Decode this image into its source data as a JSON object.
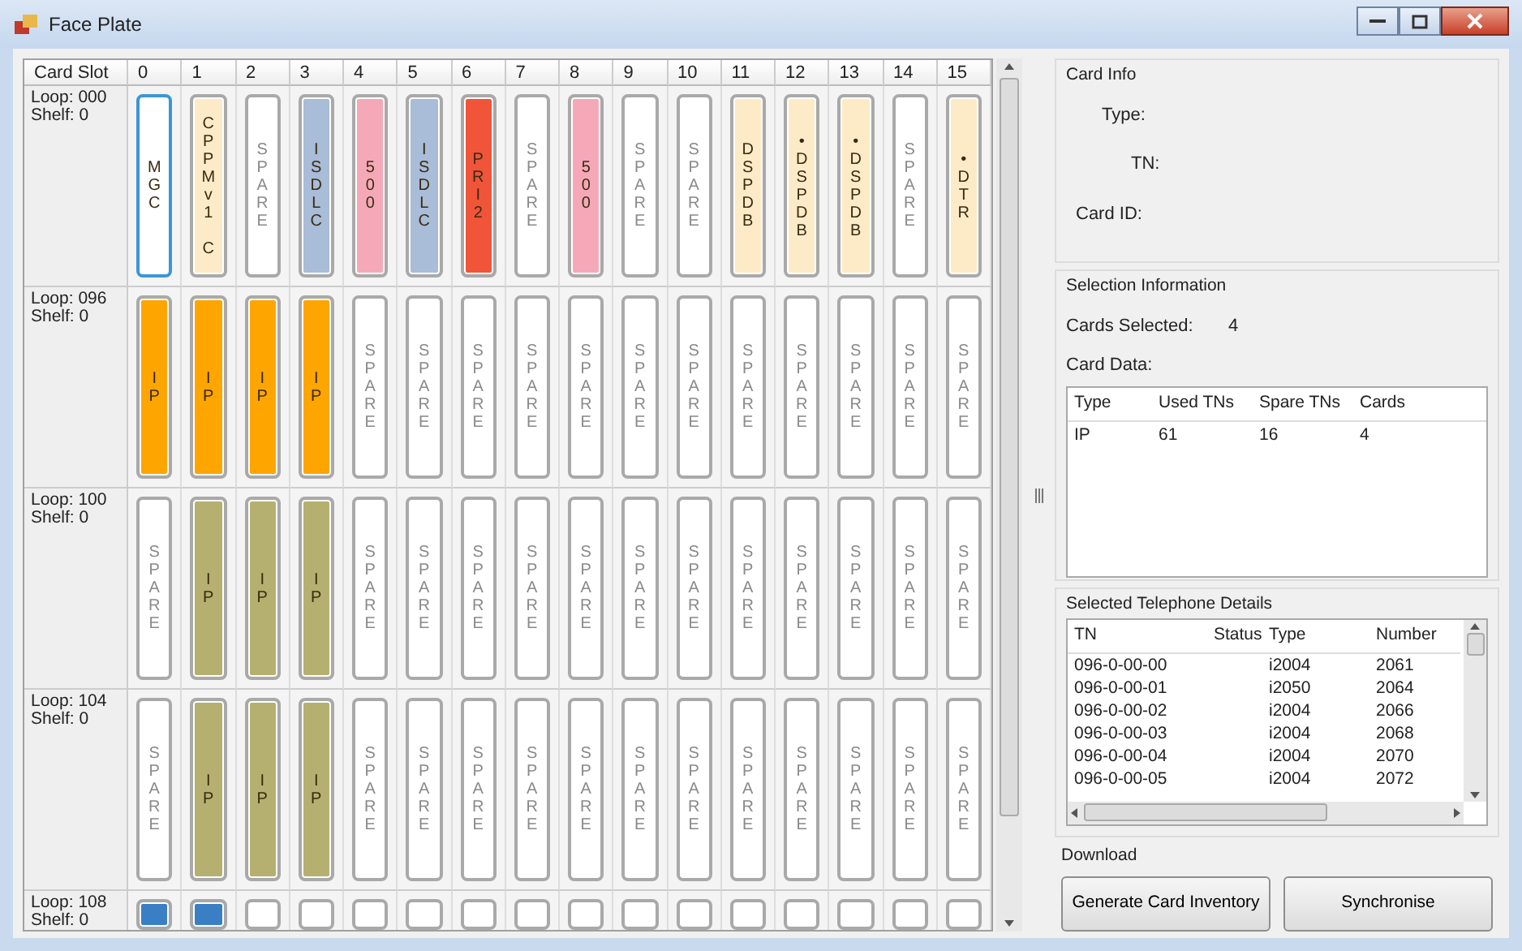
{
  "window": {
    "title": "Face Plate"
  },
  "grid": {
    "columns": [
      "Card Slot",
      "0",
      "1",
      "2",
      "3",
      "4",
      "5",
      "6",
      "7",
      "8",
      "9",
      "10",
      "11",
      "12",
      "13",
      "14",
      "15"
    ],
    "rows": [
      {
        "loop": "Loop: 000",
        "shelf": "Shelf: 0",
        "cards": [
          {
            "kind": "card",
            "label": "MGC",
            "color": "#ffffff",
            "selected": true
          },
          {
            "kind": "card",
            "label": "CPPMv1 C",
            "color": "#fdebc8",
            "selected": false
          },
          {
            "kind": "spare",
            "label": "SPARE",
            "color": "#ffffff",
            "selected": false
          },
          {
            "kind": "card",
            "label": "ISDLC",
            "color": "#a9bcd8",
            "selected": false
          },
          {
            "kind": "card",
            "label": "500",
            "color": "#f5a9b8",
            "selected": false
          },
          {
            "kind": "card",
            "label": "ISDLC",
            "color": "#a9bcd8",
            "selected": false
          },
          {
            "kind": "card",
            "label": "PRI2",
            "color": "#f0553a",
            "selected": false
          },
          {
            "kind": "spare",
            "label": "SPARE",
            "color": "#ffffff",
            "selected": false
          },
          {
            "kind": "card",
            "label": "500",
            "color": "#f5a9b8",
            "selected": false
          },
          {
            "kind": "spare",
            "label": "SPARE",
            "color": "#ffffff",
            "selected": false
          },
          {
            "kind": "spare",
            "label": "SPARE",
            "color": "#ffffff",
            "selected": false
          },
          {
            "kind": "card",
            "label": "DSPDB",
            "color": "#fdebc8",
            "selected": false
          },
          {
            "kind": "card",
            "label": "•DSPDB",
            "color": "#fdebc8",
            "selected": false
          },
          {
            "kind": "card",
            "label": "•DSPDB",
            "color": "#fdebc8",
            "selected": false
          },
          {
            "kind": "spare",
            "label": "SPARE",
            "color": "#ffffff",
            "selected": false
          },
          {
            "kind": "card",
            "label": "•DTR",
            "color": "#fdebc8",
            "selected": false
          }
        ]
      },
      {
        "loop": "Loop: 096",
        "shelf": "Shelf: 0",
        "cards": [
          {
            "kind": "card",
            "label": "IP",
            "color": "#ffa500",
            "selected": false
          },
          {
            "kind": "card",
            "label": "IP",
            "color": "#ffa500",
            "selected": false
          },
          {
            "kind": "card",
            "label": "IP",
            "color": "#ffa500",
            "selected": false
          },
          {
            "kind": "card",
            "label": "IP",
            "color": "#ffa500",
            "selected": false
          },
          {
            "kind": "spare",
            "label": "SPARE",
            "color": "#ffffff",
            "selected": false
          },
          {
            "kind": "spare",
            "label": "SPARE",
            "color": "#ffffff",
            "selected": false
          },
          {
            "kind": "spare",
            "label": "SPARE",
            "color": "#ffffff",
            "selected": false
          },
          {
            "kind": "spare",
            "label": "SPARE",
            "color": "#ffffff",
            "selected": false
          },
          {
            "kind": "spare",
            "label": "SPARE",
            "color": "#ffffff",
            "selected": false
          },
          {
            "kind": "spare",
            "label": "SPARE",
            "color": "#ffffff",
            "selected": false
          },
          {
            "kind": "spare",
            "label": "SPARE",
            "color": "#ffffff",
            "selected": false
          },
          {
            "kind": "spare",
            "label": "SPARE",
            "color": "#ffffff",
            "selected": false
          },
          {
            "kind": "spare",
            "label": "SPARE",
            "color": "#ffffff",
            "selected": false
          },
          {
            "kind": "spare",
            "label": "SPARE",
            "color": "#ffffff",
            "selected": false
          },
          {
            "kind": "spare",
            "label": "SPARE",
            "color": "#ffffff",
            "selected": false
          },
          {
            "kind": "spare",
            "label": "SPARE",
            "color": "#ffffff",
            "selected": false
          }
        ]
      },
      {
        "loop": "Loop: 100",
        "shelf": "Shelf: 0",
        "cards": [
          {
            "kind": "spare",
            "label": "SPARE",
            "color": "#ffffff",
            "selected": false
          },
          {
            "kind": "card",
            "label": "IP",
            "color": "#b5b070",
            "selected": false
          },
          {
            "kind": "card",
            "label": "IP",
            "color": "#b5b070",
            "selected": false
          },
          {
            "kind": "card",
            "label": "IP",
            "color": "#b5b070",
            "selected": false
          },
          {
            "kind": "spare",
            "label": "SPARE",
            "color": "#ffffff",
            "selected": false
          },
          {
            "kind": "spare",
            "label": "SPARE",
            "color": "#ffffff",
            "selected": false
          },
          {
            "kind": "spare",
            "label": "SPARE",
            "color": "#ffffff",
            "selected": false
          },
          {
            "kind": "spare",
            "label": "SPARE",
            "color": "#ffffff",
            "selected": false
          },
          {
            "kind": "spare",
            "label": "SPARE",
            "color": "#ffffff",
            "selected": false
          },
          {
            "kind": "spare",
            "label": "SPARE",
            "color": "#ffffff",
            "selected": false
          },
          {
            "kind": "spare",
            "label": "SPARE",
            "color": "#ffffff",
            "selected": false
          },
          {
            "kind": "spare",
            "label": "SPARE",
            "color": "#ffffff",
            "selected": false
          },
          {
            "kind": "spare",
            "label": "SPARE",
            "color": "#ffffff",
            "selected": false
          },
          {
            "kind": "spare",
            "label": "SPARE",
            "color": "#ffffff",
            "selected": false
          },
          {
            "kind": "spare",
            "label": "SPARE",
            "color": "#ffffff",
            "selected": false
          },
          {
            "kind": "spare",
            "label": "SPARE",
            "color": "#ffffff",
            "selected": false
          }
        ]
      },
      {
        "loop": "Loop: 104",
        "shelf": "Shelf: 0",
        "cards": [
          {
            "kind": "spare",
            "label": "SPARE",
            "color": "#ffffff",
            "selected": false
          },
          {
            "kind": "card",
            "label": "IP",
            "color": "#b5b070",
            "selected": false
          },
          {
            "kind": "card",
            "label": "IP",
            "color": "#b5b070",
            "selected": false
          },
          {
            "kind": "card",
            "label": "IP",
            "color": "#b5b070",
            "selected": false
          },
          {
            "kind": "spare",
            "label": "SPARE",
            "color": "#ffffff",
            "selected": false
          },
          {
            "kind": "spare",
            "label": "SPARE",
            "color": "#ffffff",
            "selected": false
          },
          {
            "kind": "spare",
            "label": "SPARE",
            "color": "#ffffff",
            "selected": false
          },
          {
            "kind": "spare",
            "label": "SPARE",
            "color": "#ffffff",
            "selected": false
          },
          {
            "kind": "spare",
            "label": "SPARE",
            "color": "#ffffff",
            "selected": false
          },
          {
            "kind": "spare",
            "label": "SPARE",
            "color": "#ffffff",
            "selected": false
          },
          {
            "kind": "spare",
            "label": "SPARE",
            "color": "#ffffff",
            "selected": false
          },
          {
            "kind": "spare",
            "label": "SPARE",
            "color": "#ffffff",
            "selected": false
          },
          {
            "kind": "spare",
            "label": "SPARE",
            "color": "#ffffff",
            "selected": false
          },
          {
            "kind": "spare",
            "label": "SPARE",
            "color": "#ffffff",
            "selected": false
          },
          {
            "kind": "spare",
            "label": "SPARE",
            "color": "#ffffff",
            "selected": false
          },
          {
            "kind": "spare",
            "label": "SPARE",
            "color": "#ffffff",
            "selected": false
          }
        ]
      },
      {
        "loop": "Loop: 108",
        "shelf": "Shelf: 0",
        "cards": [
          {
            "kind": "empty",
            "color": "#3a7fc4",
            "selected": false
          },
          {
            "kind": "empty",
            "color": "#3a7fc4",
            "selected": false
          },
          {
            "kind": "empty",
            "color": "#ffffff",
            "selected": false
          },
          {
            "kind": "empty",
            "color": "#ffffff",
            "selected": false
          },
          {
            "kind": "empty",
            "color": "#ffffff",
            "selected": false
          },
          {
            "kind": "empty",
            "color": "#ffffff",
            "selected": false
          },
          {
            "kind": "empty",
            "color": "#ffffff",
            "selected": false
          },
          {
            "kind": "empty",
            "color": "#ffffff",
            "selected": false
          },
          {
            "kind": "empty",
            "color": "#ffffff",
            "selected": false
          },
          {
            "kind": "empty",
            "color": "#ffffff",
            "selected": false
          },
          {
            "kind": "empty",
            "color": "#ffffff",
            "selected": false
          },
          {
            "kind": "empty",
            "color": "#ffffff",
            "selected": false
          },
          {
            "kind": "empty",
            "color": "#ffffff",
            "selected": false
          },
          {
            "kind": "empty",
            "color": "#ffffff",
            "selected": false
          },
          {
            "kind": "empty",
            "color": "#ffffff",
            "selected": false
          },
          {
            "kind": "empty",
            "color": "#ffffff",
            "selected": false
          }
        ]
      }
    ]
  },
  "card_info": {
    "title": "Card Info",
    "fields": [
      {
        "label": "Type:"
      },
      {
        "label": "TN:"
      },
      {
        "label": "Card ID:"
      }
    ]
  },
  "selection": {
    "title": "Selection Information",
    "cards_selected_label": "Cards Selected:",
    "cards_selected": "4",
    "card_data_label": "Card Data:",
    "table": {
      "columns": [
        "Type",
        "Used TNs",
        "Spare TNs",
        "Cards"
      ],
      "rows": [
        [
          "IP",
          "61",
          "16",
          "4"
        ]
      ]
    }
  },
  "telephone": {
    "title": "Selected Telephone Details",
    "columns": [
      "TN",
      "Status",
      "Type",
      "Number"
    ],
    "rows": [
      {
        "tn": "096-0-00-00",
        "type": "i2004",
        "number": "2061"
      },
      {
        "tn": "096-0-00-01",
        "type": "i2050",
        "number": "2064"
      },
      {
        "tn": "096-0-00-02",
        "type": "i2004",
        "number": "2066"
      },
      {
        "tn": "096-0-00-03",
        "type": "i2004",
        "number": "2068"
      },
      {
        "tn": "096-0-00-04",
        "type": "i2004",
        "number": "2070"
      },
      {
        "tn": "096-0-00-05",
        "type": "i2004",
        "number": "2072"
      }
    ]
  },
  "download": {
    "title": "Download",
    "buttons": [
      "Generate Card Inventory",
      "Synchronise"
    ]
  }
}
